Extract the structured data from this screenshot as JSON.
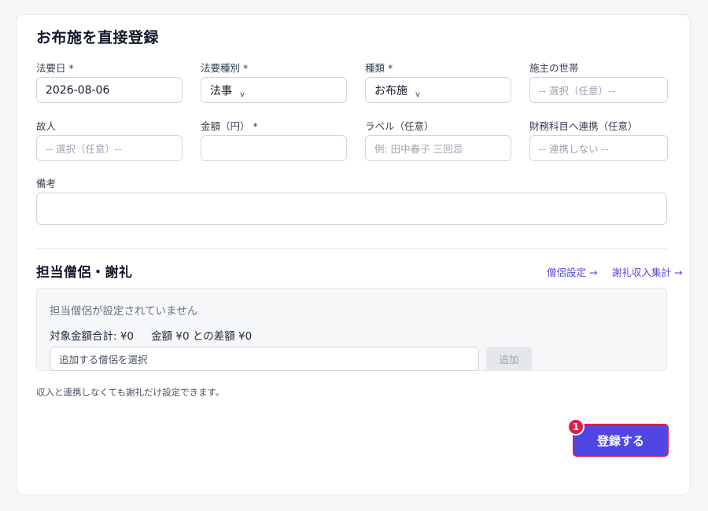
{
  "form": {
    "title": "お布施を直接登録",
    "fields": {
      "memorial_date": {
        "label": "法要日 *",
        "value": "2026-08-06"
      },
      "memorial_type": {
        "label": "法要種別 *",
        "value": "法事",
        "chevron": "v"
      },
      "kind": {
        "label": "種類 *",
        "value": "お布施",
        "chevron": "v"
      },
      "householder": {
        "label": "施主の世帯",
        "placeholder": "-- 選択（任意）--"
      },
      "deceased": {
        "label": "故人",
        "placeholder": "-- 選択（任意）--"
      },
      "amount": {
        "label": "金額（円） *",
        "value": ""
      },
      "tag": {
        "label": "ラベル（任意）",
        "placeholder": "例: 田中春子 三回忌"
      },
      "account_link": {
        "label": "財務科目へ連携（任意）",
        "placeholder": "-- 連携しない --"
      },
      "remarks": {
        "label": "備考",
        "value": ""
      }
    }
  },
  "monk_section": {
    "title": "担当僧侶・謝礼",
    "links": {
      "monk_settings": "僧侶設定 →",
      "honorarium_summary": "謝礼収入集計 →"
    },
    "empty_message": "担当僧侶が設定されていません",
    "totals_text": "対象金額合計: ¥0 　 金額 ¥0 との差額 ¥0",
    "select_placeholder": "追加する僧侶を選択",
    "add_button": "追加",
    "note": "収入と連携しなくても謝礼だけ設定できます。"
  },
  "actions": {
    "submit_label": "登録する",
    "badge_number": "1"
  },
  "colors": {
    "accent": "#4f46e5",
    "highlight_border": "#e11d48",
    "badge": "#e11d48"
  }
}
